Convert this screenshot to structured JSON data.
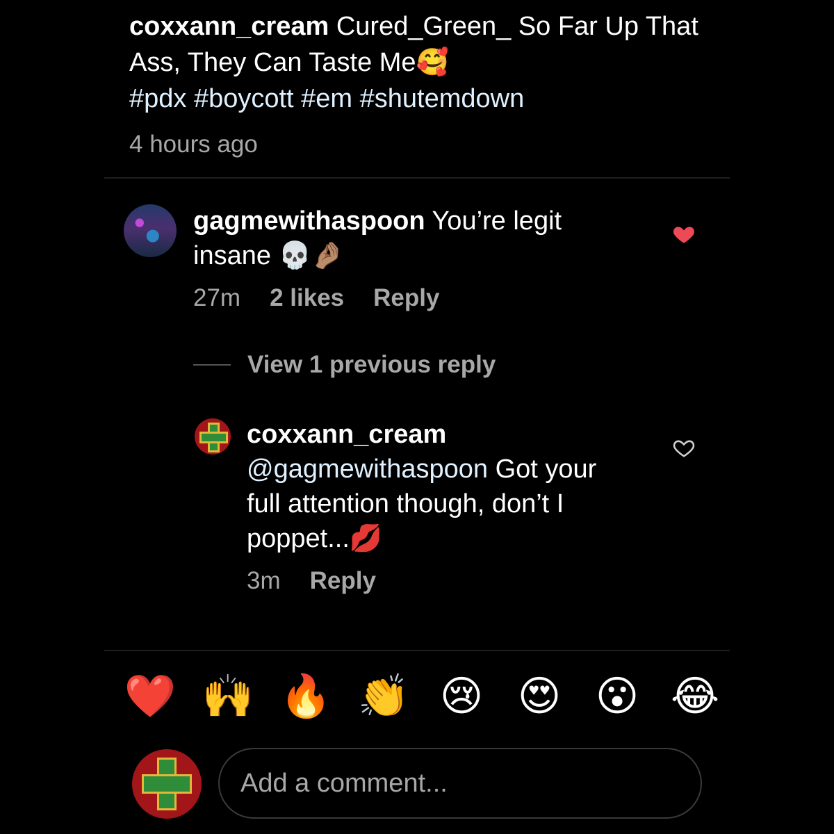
{
  "caption": {
    "username": "coxxann_cream",
    "text": "Cured_Green_ So Far Up That Ass, They Can Taste Me",
    "emoji": "🥰",
    "hashtags": "#pdx #boycott #em #shutemdown",
    "time": "4 hours ago"
  },
  "comments": [
    {
      "username": "gagmewithaspoon",
      "text": "You’re legit insane",
      "emoji": "💀🤌🏽",
      "time": "27m",
      "likes": "2 likes",
      "reply_label": "Reply",
      "liked": true
    }
  ],
  "view_replies_label": "View 1 previous reply",
  "reply": {
    "username": "coxxann_cream",
    "mention": "@gagmewithaspoon",
    "text": "Got your full attention though, don’t I poppet...",
    "emoji": "💋",
    "time": "3m",
    "reply_label": "Reply",
    "liked": false
  },
  "reactions": [
    "❤️",
    "🙌",
    "🔥",
    "👏",
    "😢",
    "😍",
    "😮",
    "😂"
  ],
  "composer": {
    "placeholder": "Add a comment..."
  },
  "colors": {
    "background": "#000000",
    "like_red": "#ed4956",
    "secondary_text": "#a8a8a8"
  }
}
